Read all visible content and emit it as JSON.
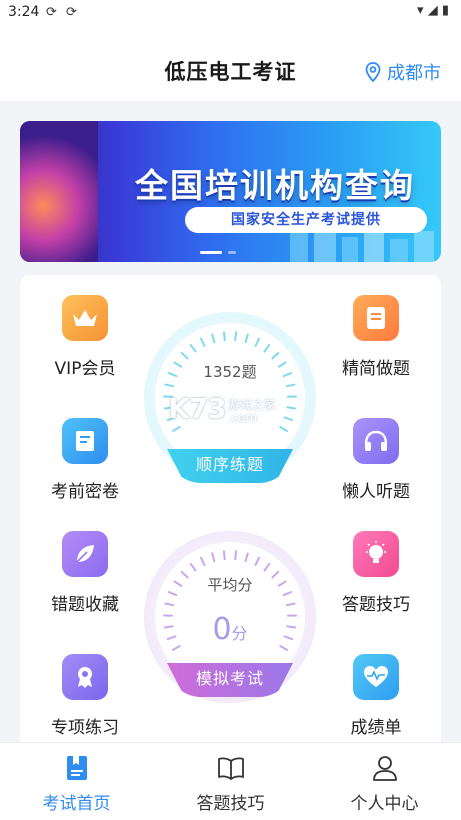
{
  "status_bar": {
    "time": "3:24",
    "icons": [
      "sync-icon",
      "sync-icon",
      "wifi-icon",
      "signal-icon",
      "battery-icon"
    ]
  },
  "header": {
    "title": "低压电工考证",
    "location": "成都市"
  },
  "banner": {
    "title": "全国培训机构查询",
    "subtitle": "国家安全生产考试提供",
    "slide_index": 1,
    "slide_count": 2
  },
  "features": {
    "vip": "VIP会员",
    "concise": "精简做题",
    "secret": "考前密卷",
    "listen": "懒人听题",
    "wrong": "错题收藏",
    "tips": "答题技巧",
    "special": "专项练习",
    "report": "成绩单"
  },
  "practice_gauge": {
    "count_text": "1352题",
    "button": "顺序练题"
  },
  "exam_gauge": {
    "label": "平均分",
    "score": "0",
    "unit": "分",
    "button": "模拟考试"
  },
  "watermark": {
    "logo": "K73",
    "text_top": "游戏之家",
    "text_bottom": ".com"
  },
  "tabs": [
    {
      "label": "考试首页",
      "icon": "exam-home-icon",
      "active": true
    },
    {
      "label": "答题技巧",
      "icon": "book-icon",
      "active": false
    },
    {
      "label": "个人中心",
      "icon": "person-icon",
      "active": false
    }
  ],
  "colors": {
    "accent": "#2f8cf0",
    "vip": "#f7a43a",
    "concise": "#ff8a3d",
    "secret": "#2fa6ee",
    "listen": "#8f7bf0",
    "wrong": "#a57af0",
    "tips": "#f45fa2",
    "special": "#8a74ee",
    "report": "#2fb4f0"
  }
}
